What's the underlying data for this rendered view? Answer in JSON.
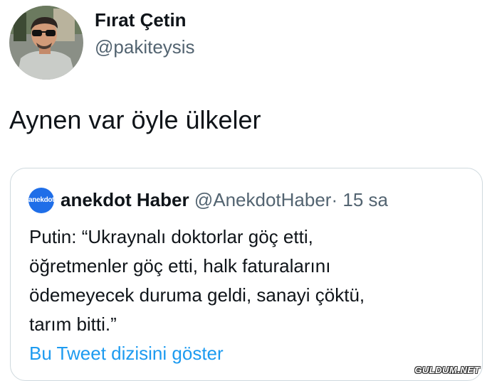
{
  "author": {
    "display_name": "Fırat Çetin",
    "handle": "@pakiteysis",
    "avatar_icon": "profile-photo"
  },
  "tweet": {
    "text": "Aynen var öyle ülkeler"
  },
  "quote": {
    "avatar_text": "anekdot",
    "avatar_color": "#1f6ee8",
    "display_name": "anekdot Haber",
    "handle": "@AnekdotHaber",
    "separator": "·",
    "time": "15 sa",
    "lines": [
      "Putin: “Ukraynalı doktorlar göç etti,",
      "öğretmenler göç etti, halk faturalarını",
      "ödemeyecek duruma geldi, sanayi çöktü,",
      "tarım bitti.”"
    ],
    "show_thread_label": "Bu Tweet dizisini göster"
  },
  "watermark": "GULDUM.NET",
  "colors": {
    "text": "#0f1419",
    "secondary": "#536471",
    "link": "#1d9bf0",
    "border": "#cfd9de"
  }
}
